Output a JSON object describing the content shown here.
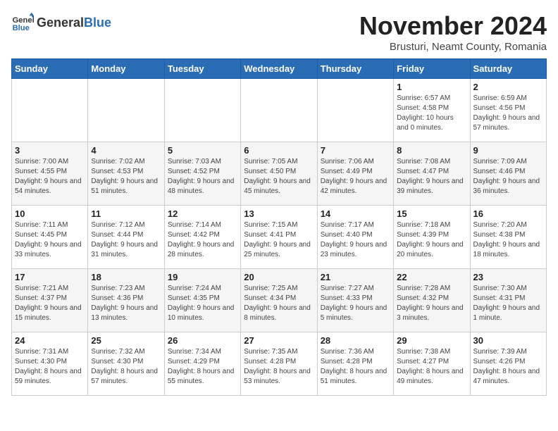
{
  "header": {
    "logo_general": "General",
    "logo_blue": "Blue",
    "month_title": "November 2024",
    "subtitle": "Brusturi, Neamt County, Romania"
  },
  "calendar": {
    "days_of_week": [
      "Sunday",
      "Monday",
      "Tuesday",
      "Wednesday",
      "Thursday",
      "Friday",
      "Saturday"
    ],
    "weeks": [
      [
        {
          "day": "",
          "info": ""
        },
        {
          "day": "",
          "info": ""
        },
        {
          "day": "",
          "info": ""
        },
        {
          "day": "",
          "info": ""
        },
        {
          "day": "",
          "info": ""
        },
        {
          "day": "1",
          "info": "Sunrise: 6:57 AM\nSunset: 4:58 PM\nDaylight: 10 hours and 0 minutes."
        },
        {
          "day": "2",
          "info": "Sunrise: 6:59 AM\nSunset: 4:56 PM\nDaylight: 9 hours and 57 minutes."
        }
      ],
      [
        {
          "day": "3",
          "info": "Sunrise: 7:00 AM\nSunset: 4:55 PM\nDaylight: 9 hours and 54 minutes."
        },
        {
          "day": "4",
          "info": "Sunrise: 7:02 AM\nSunset: 4:53 PM\nDaylight: 9 hours and 51 minutes."
        },
        {
          "day": "5",
          "info": "Sunrise: 7:03 AM\nSunset: 4:52 PM\nDaylight: 9 hours and 48 minutes."
        },
        {
          "day": "6",
          "info": "Sunrise: 7:05 AM\nSunset: 4:50 PM\nDaylight: 9 hours and 45 minutes."
        },
        {
          "day": "7",
          "info": "Sunrise: 7:06 AM\nSunset: 4:49 PM\nDaylight: 9 hours and 42 minutes."
        },
        {
          "day": "8",
          "info": "Sunrise: 7:08 AM\nSunset: 4:47 PM\nDaylight: 9 hours and 39 minutes."
        },
        {
          "day": "9",
          "info": "Sunrise: 7:09 AM\nSunset: 4:46 PM\nDaylight: 9 hours and 36 minutes."
        }
      ],
      [
        {
          "day": "10",
          "info": "Sunrise: 7:11 AM\nSunset: 4:45 PM\nDaylight: 9 hours and 33 minutes."
        },
        {
          "day": "11",
          "info": "Sunrise: 7:12 AM\nSunset: 4:44 PM\nDaylight: 9 hours and 31 minutes."
        },
        {
          "day": "12",
          "info": "Sunrise: 7:14 AM\nSunset: 4:42 PM\nDaylight: 9 hours and 28 minutes."
        },
        {
          "day": "13",
          "info": "Sunrise: 7:15 AM\nSunset: 4:41 PM\nDaylight: 9 hours and 25 minutes."
        },
        {
          "day": "14",
          "info": "Sunrise: 7:17 AM\nSunset: 4:40 PM\nDaylight: 9 hours and 23 minutes."
        },
        {
          "day": "15",
          "info": "Sunrise: 7:18 AM\nSunset: 4:39 PM\nDaylight: 9 hours and 20 minutes."
        },
        {
          "day": "16",
          "info": "Sunrise: 7:20 AM\nSunset: 4:38 PM\nDaylight: 9 hours and 18 minutes."
        }
      ],
      [
        {
          "day": "17",
          "info": "Sunrise: 7:21 AM\nSunset: 4:37 PM\nDaylight: 9 hours and 15 minutes."
        },
        {
          "day": "18",
          "info": "Sunrise: 7:23 AM\nSunset: 4:36 PM\nDaylight: 9 hours and 13 minutes."
        },
        {
          "day": "19",
          "info": "Sunrise: 7:24 AM\nSunset: 4:35 PM\nDaylight: 9 hours and 10 minutes."
        },
        {
          "day": "20",
          "info": "Sunrise: 7:25 AM\nSunset: 4:34 PM\nDaylight: 9 hours and 8 minutes."
        },
        {
          "day": "21",
          "info": "Sunrise: 7:27 AM\nSunset: 4:33 PM\nDaylight: 9 hours and 5 minutes."
        },
        {
          "day": "22",
          "info": "Sunrise: 7:28 AM\nSunset: 4:32 PM\nDaylight: 9 hours and 3 minutes."
        },
        {
          "day": "23",
          "info": "Sunrise: 7:30 AM\nSunset: 4:31 PM\nDaylight: 9 hours and 1 minute."
        }
      ],
      [
        {
          "day": "24",
          "info": "Sunrise: 7:31 AM\nSunset: 4:30 PM\nDaylight: 8 hours and 59 minutes."
        },
        {
          "day": "25",
          "info": "Sunrise: 7:32 AM\nSunset: 4:30 PM\nDaylight: 8 hours and 57 minutes."
        },
        {
          "day": "26",
          "info": "Sunrise: 7:34 AM\nSunset: 4:29 PM\nDaylight: 8 hours and 55 minutes."
        },
        {
          "day": "27",
          "info": "Sunrise: 7:35 AM\nSunset: 4:28 PM\nDaylight: 8 hours and 53 minutes."
        },
        {
          "day": "28",
          "info": "Sunrise: 7:36 AM\nSunset: 4:28 PM\nDaylight: 8 hours and 51 minutes."
        },
        {
          "day": "29",
          "info": "Sunrise: 7:38 AM\nSunset: 4:27 PM\nDaylight: 8 hours and 49 minutes."
        },
        {
          "day": "30",
          "info": "Sunrise: 7:39 AM\nSunset: 4:26 PM\nDaylight: 8 hours and 47 minutes."
        }
      ]
    ]
  }
}
